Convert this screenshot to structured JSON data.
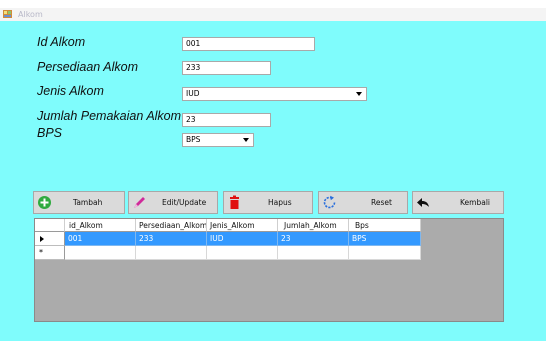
{
  "window": {
    "title": "Alkom"
  },
  "form": {
    "id_label": "Id Alkom",
    "id_value": "001",
    "persediaan_label": "Persediaan Alkom",
    "persediaan_value": "233",
    "jenis_label": "Jenis Alkom",
    "jenis_value": "IUD",
    "jumlah_label": "Jumlah Pemakaian Alkom",
    "jumlah_value": "23",
    "bps_label": "BPS",
    "bps_value": "BPS"
  },
  "buttons": {
    "tambah": "Tambah",
    "edit": "Edit/Update",
    "hapus": "Hapus",
    "reset": "Reset",
    "kembali": "Kembali"
  },
  "grid": {
    "columns": [
      "id_Alkom",
      "Persediaan_Alkom",
      "Jenis_Alkom",
      "Jumlah_Alkom",
      "Bps"
    ],
    "rows": [
      [
        "001",
        "233",
        "IUD",
        "23",
        "BPS"
      ]
    ],
    "new_row_marker": "*"
  },
  "colors": {
    "background": "#7ffcfc",
    "selection": "#3399ff",
    "button": "#dadada"
  }
}
